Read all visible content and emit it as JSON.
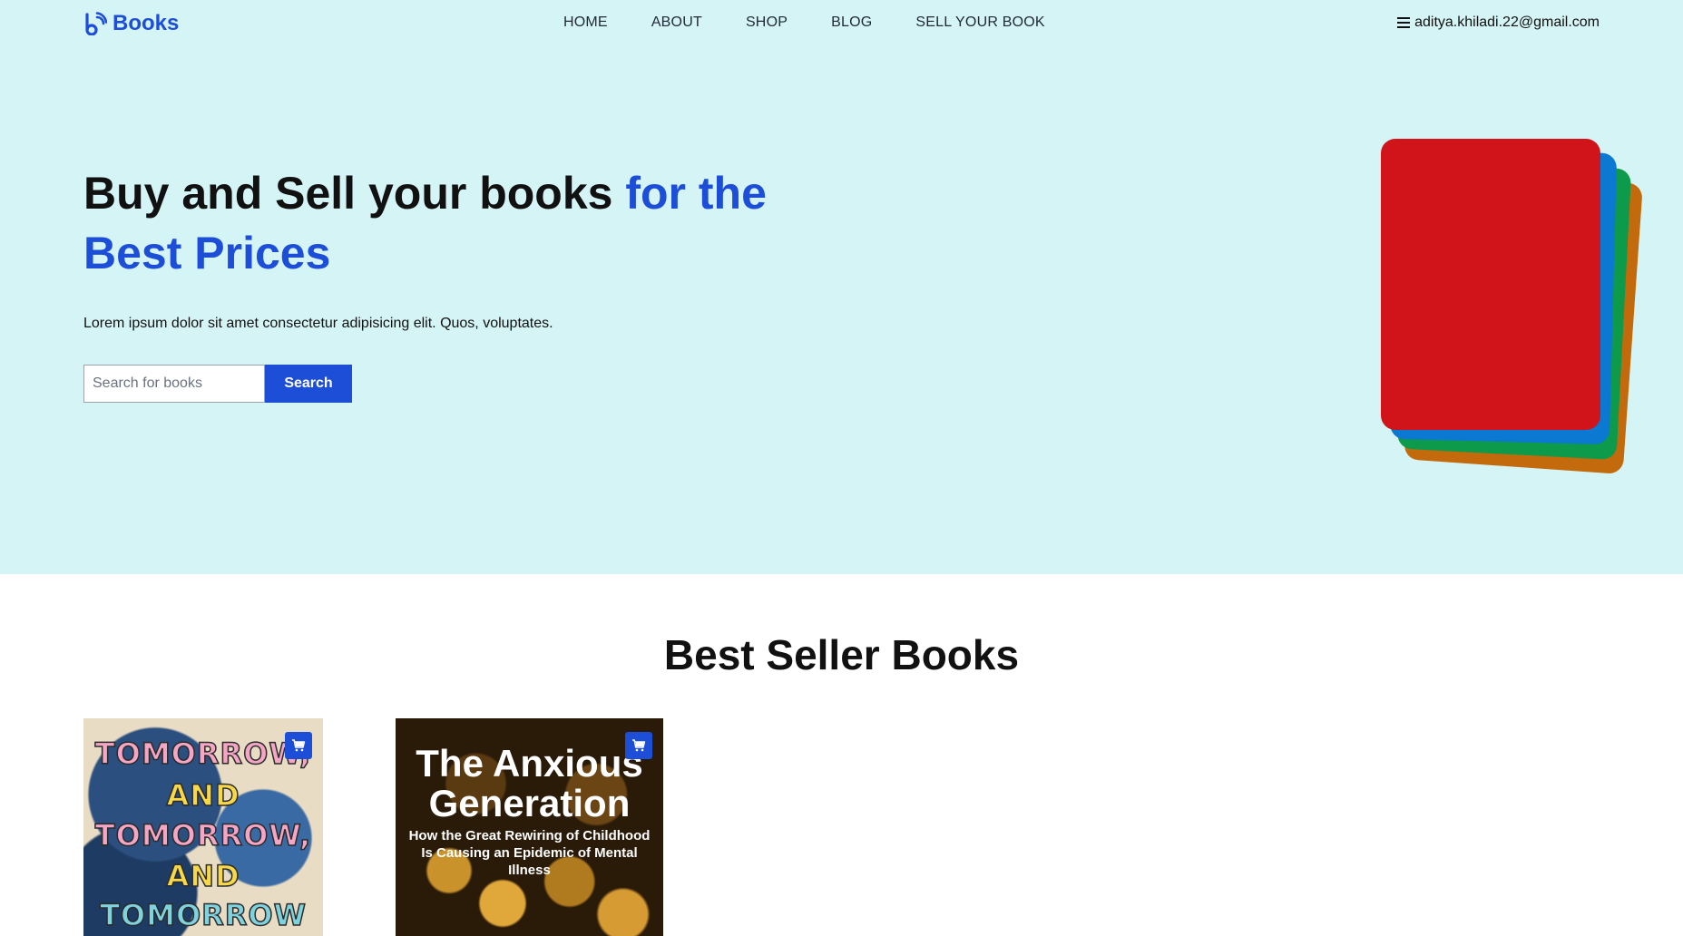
{
  "brand": {
    "name": "Books",
    "icon": "book-logo-icon",
    "color": "#1d4ed8"
  },
  "nav": {
    "items": [
      "HOME",
      "ABOUT",
      "SHOP",
      "BLOG",
      "SELL YOUR BOOK"
    ],
    "account_email": "aditya.khiladi.22@gmail.com"
  },
  "hero": {
    "title_plain": "Buy and Sell your books ",
    "title_accent": "for the Best Prices",
    "subtitle": "Lorem ipsum dolor sit amet consectetur adipisicing elit. Quos, voluptates.",
    "search_placeholder": "Search for books",
    "search_button": "Search",
    "card_colors": [
      "#d1131a",
      "#0b78d1",
      "#0d9a4a",
      "#c26a0c"
    ]
  },
  "bestsellers": {
    "heading": "Best Seller Books",
    "books": [
      {
        "cover_lines": [
          "TOMORROW,",
          "AND",
          "TOMORROW,",
          "AND",
          "TOMORROW"
        ]
      },
      {
        "title": "The Anxious Generation",
        "subtitle": "How the Great Rewiring of Childhood Is Causing an Epidemic of Mental Illness"
      }
    ]
  },
  "colors": {
    "hero_bg": "#d5f4f6",
    "accent": "#1d4ed8"
  }
}
